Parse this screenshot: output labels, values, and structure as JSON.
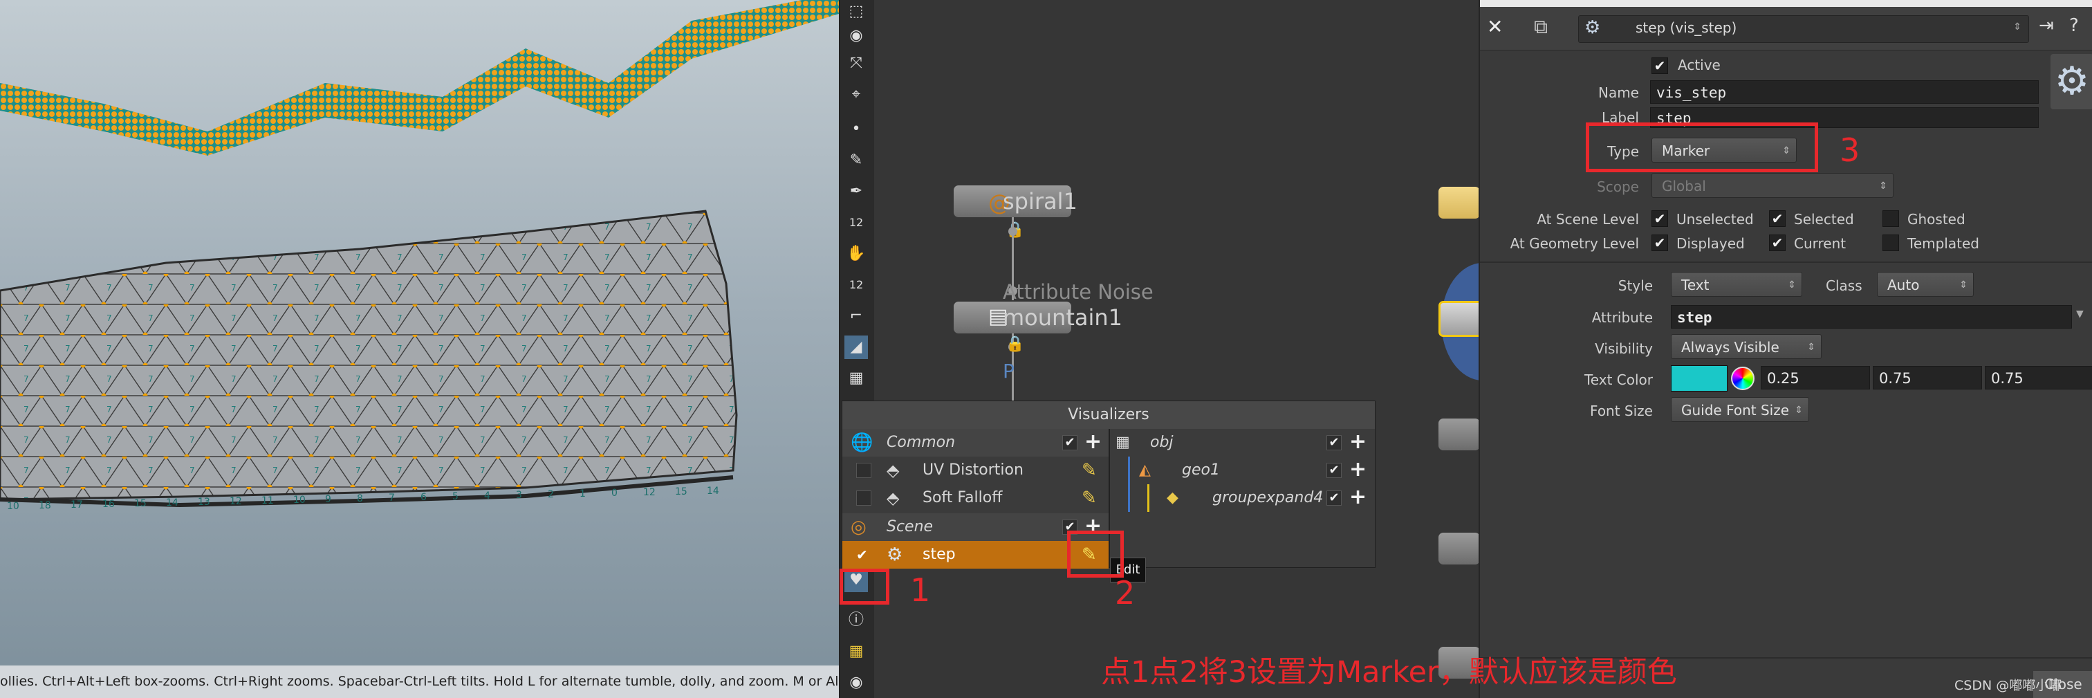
{
  "viewport": {
    "status_text": "ollies. Ctrl+Alt+Left box-zooms. Ctrl+Right zooms. Spacebar-Ctrl-Left tilts. Hold L for alternate tumble, dolly, and zoom.     M or Alt+M for",
    "point_numbers": [
      "10",
      "18",
      "17",
      "16",
      "15",
      "14",
      "13",
      "12",
      "11",
      "10",
      "9",
      "8",
      "7",
      "6",
      "5",
      "4",
      "3",
      "2",
      "1",
      "0",
      "12",
      "15",
      "14"
    ]
  },
  "toolbar": {
    "tools": [
      "select-icon",
      "view-icon",
      "transform-icon",
      "handle-icon",
      "point-icon",
      "paint-icon",
      "pen-icon",
      "number-icon",
      "hand-icon",
      "number-icon",
      "curve-icon",
      "snap-icon",
      "checker-icon"
    ],
    "bottom_tools": [
      "visualizer-icon",
      "info-icon",
      "grid-icon",
      "eye-icon"
    ],
    "num_label_1": "12",
    "num_label_2": "12"
  },
  "network": {
    "nodes": [
      {
        "name": "spiral1",
        "sub": ""
      },
      {
        "name": "mountain1",
        "sub": "Attribute Noise"
      }
    ],
    "flag": "P"
  },
  "visualizers": {
    "title": "Visualizers",
    "common_label": "Common",
    "items_common": [
      "UV Distortion",
      "Soft Falloff"
    ],
    "scene_label": "Scene",
    "scene_item": "step",
    "tooltip": "Edit",
    "tree": [
      "obj",
      "geo1",
      "groupexpand4"
    ]
  },
  "params": {
    "header_title": "step (vis_step)",
    "active_label": "Active",
    "name_label": "Name",
    "name_value": "vis_step",
    "label_label": "Label",
    "label_value": "step",
    "type_label": "Type",
    "type_value": "Marker",
    "scope_label": "Scope",
    "scope_value": "Global",
    "scene_level_label": "At Scene Level",
    "geometry_level_label": "At Geometry Level",
    "unselected": "Unselected",
    "selected": "Selected",
    "ghosted": "Ghosted",
    "displayed": "Displayed",
    "current": "Current",
    "templated": "Templated",
    "style_label": "Style",
    "style_value": "Text",
    "class_label": "Class",
    "class_value": "Auto",
    "attribute_label": "Attribute",
    "attribute_value": "step",
    "visibility_label": "Visibility",
    "visibility_value": "Always Visible",
    "text_color_label": "Text Color",
    "color_r": "0.25",
    "color_g": "0.75",
    "color_b": "0.75",
    "text_color_swatch": "#1ac8c8",
    "font_size_label": "Font Size",
    "font_size_value": "Guide Font Size",
    "close_label": "Close"
  },
  "annotations": {
    "n1": "1",
    "n2": "2",
    "n3": "3",
    "caption": "点1点2将3设置为Marker，默认应该是颜色",
    "watermark": "CSDN @嘟嘟小嘟"
  },
  "colors": {
    "accent_orange": "#c06f0e",
    "annotation_red": "#e8282c"
  }
}
